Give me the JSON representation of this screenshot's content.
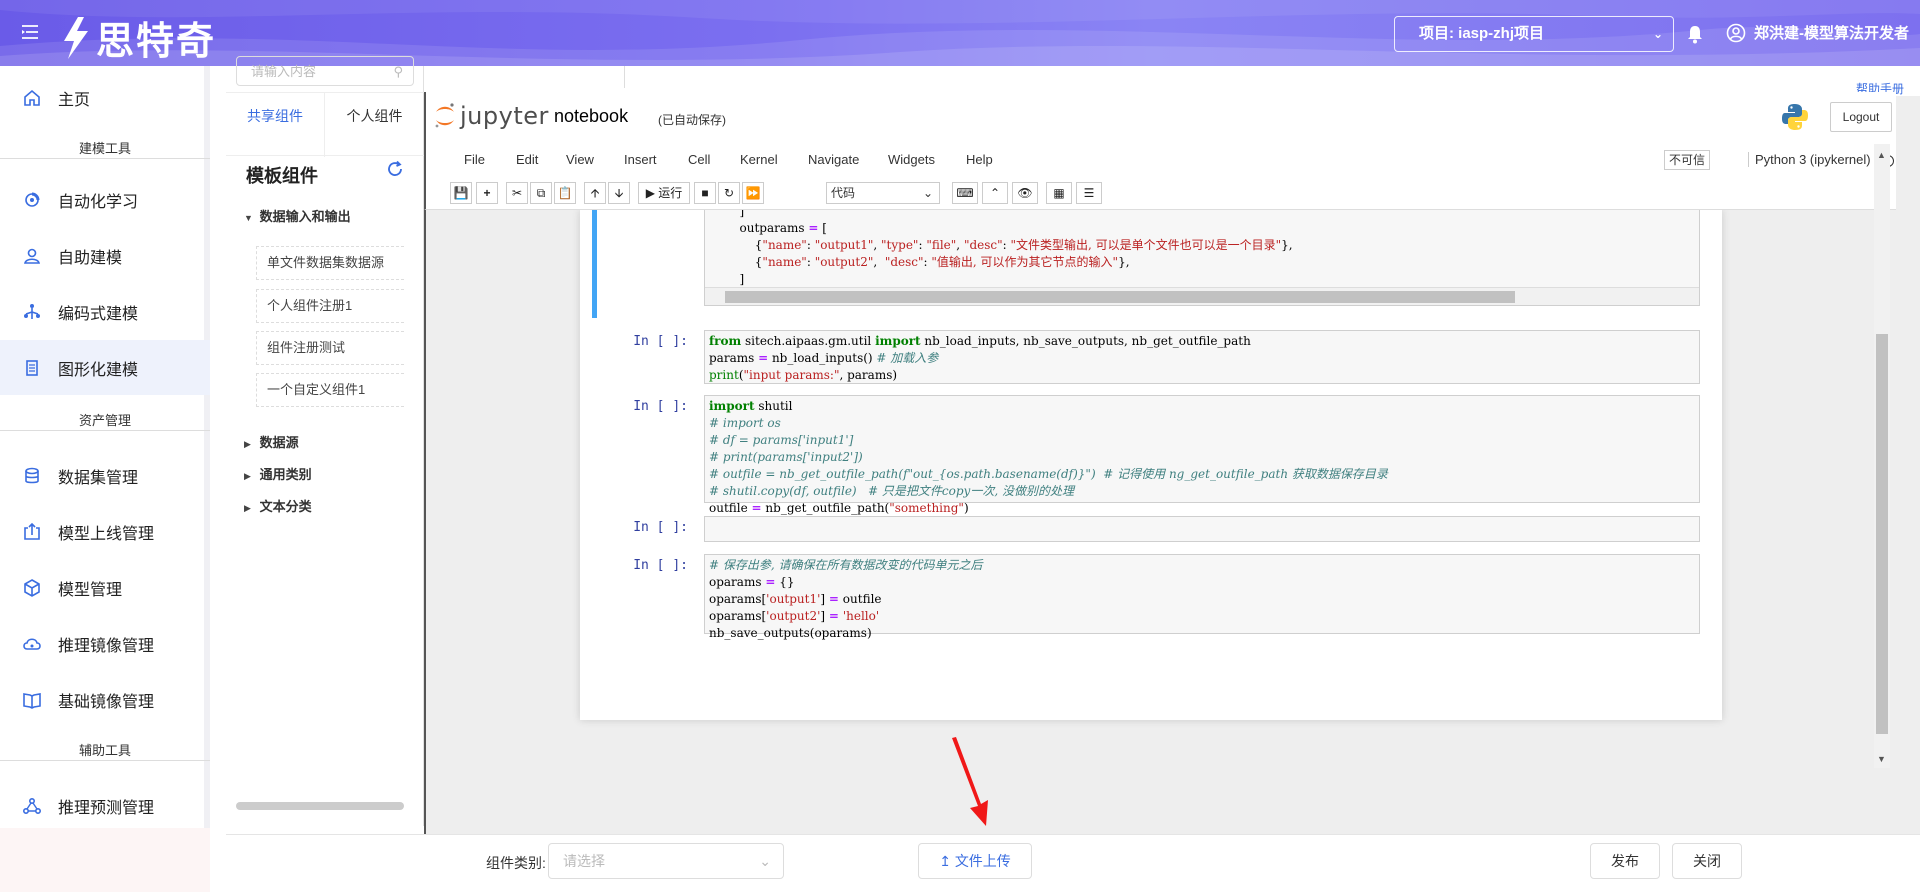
{
  "header": {
    "brand": "思特奇",
    "project": "项目: iasp-zhj项目",
    "user": "郑洪建-模型算法开发者"
  },
  "sidebar": {
    "home": "主页",
    "group_modeling": "建模工具",
    "automl": "自动化学习",
    "self_modeling": "自助建模",
    "code_modeling": "编码式建模",
    "graphic_modeling": "图形化建模",
    "group_assets": "资产管理",
    "dataset": "数据集管理",
    "model_online": "模型上线管理",
    "model_mgmt": "模型管理",
    "infer_image": "推理镜像管理",
    "base_image": "基础镜像管理",
    "group_aux": "辅助工具",
    "predict": "推理预测管理"
  },
  "components": {
    "search_placeholder": "请输入内容",
    "tab_shared": "共享组件",
    "tab_personal": "个人组件",
    "title": "模板组件",
    "node_io": "数据输入和输出",
    "items": [
      "单文件数据集数据源",
      "个人组件注册1",
      "组件注册测试",
      "一个自定义组件1"
    ],
    "node_datasource": "数据源",
    "node_general": "通用类别",
    "node_text": "文本分类"
  },
  "jupyter": {
    "logo_text": "jupyter",
    "notebook_name": "notebook",
    "autosave": "(已自动保存)",
    "logout": "Logout",
    "help_link": "帮助手册",
    "menu": [
      "File",
      "Edit",
      "View",
      "Insert",
      "Cell",
      "Kernel",
      "Navigate",
      "Widgets",
      "Help"
    ],
    "trust": "不可信",
    "kernel": "Python 3 (ipykernel)",
    "run_label": "运行",
    "cell_type": "代码",
    "prompt": "In [ ]:"
  },
  "bottom": {
    "category_label": "组件类别:",
    "category_placeholder": "请选择",
    "upload": "文件上传",
    "publish": "发布",
    "close": "关闭"
  },
  "colors": {
    "accent": "#3a6de0",
    "header_start": "#6a5be8",
    "cell_selected": "#42a5f5"
  }
}
